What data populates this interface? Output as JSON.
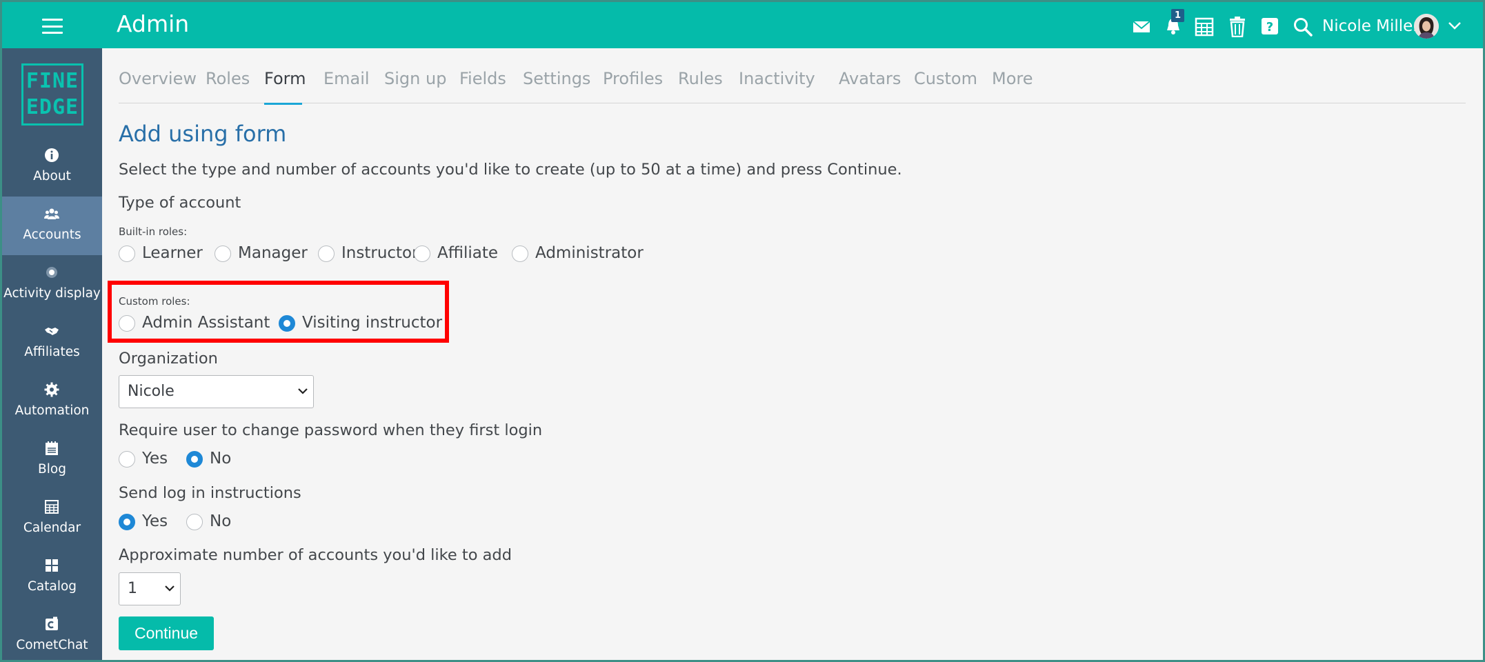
{
  "header": {
    "app_title": "Admin",
    "notification_count": "1",
    "user_name": "Nicole Miller",
    "icons": [
      "menu-icon",
      "mail-icon",
      "bell-icon",
      "calendar-grid-icon",
      "trash-icon",
      "help-icon",
      "search-icon",
      "chevron-down-icon"
    ]
  },
  "sidebar": {
    "logo_line1": "FINE",
    "logo_line2": "EDGE",
    "items": [
      {
        "label": "About",
        "icon": "info-icon"
      },
      {
        "label": "Accounts",
        "icon": "users-icon",
        "active": true
      },
      {
        "label": "Activity display",
        "icon": "dot-icon"
      },
      {
        "label": "Affiliates",
        "icon": "handshake-icon"
      },
      {
        "label": "Automation",
        "icon": "gear-icon"
      },
      {
        "label": "Blog",
        "icon": "blog-icon"
      },
      {
        "label": "Calendar",
        "icon": "calendar-icon"
      },
      {
        "label": "Catalog",
        "icon": "catalog-icon"
      },
      {
        "label": "CometChat",
        "icon": "chat-icon"
      }
    ]
  },
  "tabs": [
    "Overview",
    "Roles",
    "Form",
    "Email",
    "Sign up",
    "Fields",
    "Settings",
    "Profiles",
    "Rules",
    "Inactivity",
    "Avatars",
    "Custom",
    "More"
  ],
  "active_tab": "Form",
  "form": {
    "heading": "Add using form",
    "intro": "Select the type and number of accounts you'd like to create (up to 50 at a time) and press Continue.",
    "type_label": "Type of account",
    "builtin_label": "Built-in roles:",
    "builtin_roles": [
      "Learner",
      "Manager",
      "Instructor",
      "Affiliate",
      "Administrator"
    ],
    "custom_label": "Custom roles:",
    "custom_roles": [
      "Admin Assistant",
      "Visiting instructor"
    ],
    "custom_selected": "Visiting instructor",
    "org_label": "Organization",
    "org_value": "Nicole",
    "password_label": "Require user to change password when they first login",
    "password_options": [
      "Yes",
      "No"
    ],
    "password_selected": "No",
    "send_label": "Send log in instructions",
    "send_options": [
      "Yes",
      "No"
    ],
    "send_selected": "Yes",
    "count_label": "Approximate number of accounts you'd like to add",
    "count_value": "1",
    "continue_label": "Continue"
  }
}
